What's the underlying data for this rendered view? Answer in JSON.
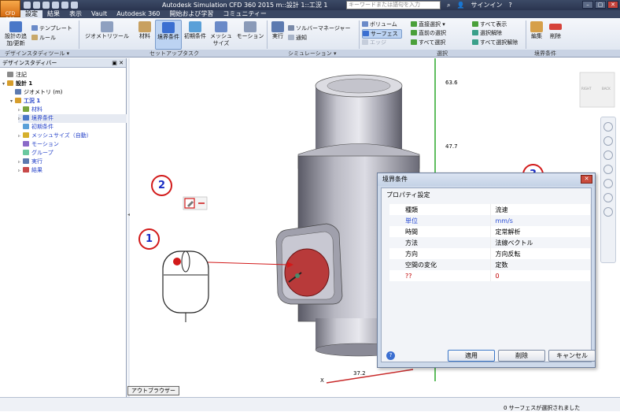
{
  "app": {
    "button_label": "CFD 360",
    "title": "Autodesk Simulation CFD 360 2015    m::設計 1::工況 1",
    "search_placeholder": "キーワードまたは語句を入力",
    "signin": "サインイン",
    "window_controls": [
      "–",
      "▢",
      "✕"
    ]
  },
  "tabs": [
    "設定",
    "結果",
    "表示",
    "Vault",
    "Autodesk 360",
    "開始および学習",
    "コミュニティー"
  ],
  "active_tab": "設定",
  "ribbon": {
    "design_study": {
      "big": "設計の追加/更新",
      "small": [
        "テンプレート",
        "ルール"
      ],
      "label": "デザインスタディツール ▾"
    },
    "setup": {
      "buttons": [
        "ジオメトリツール",
        "材料",
        "境界条件",
        "初期条件",
        "メッシュサイズ",
        "モーション"
      ],
      "label": "セットアップタスク"
    },
    "simulation": {
      "big": "実行",
      "small": [
        "ソルバーマネージャー",
        "通知"
      ],
      "label": "シミュレーション ▾"
    },
    "selection": {
      "col1": [
        "ボリューム",
        "サーフェス",
        "エッジ"
      ],
      "col2": [
        "直接選択",
        "直前の選択",
        "すべて選択"
      ],
      "col3": [
        "すべて表示",
        "選択解除",
        "すべて選択解除"
      ],
      "label": "選択"
    },
    "boundary": {
      "buttons": [
        "編集",
        "削除"
      ],
      "label": "境界条件"
    }
  },
  "panel": {
    "title": "デザインスタディバー",
    "controls": "▣ ✕",
    "items": [
      {
        "label": "注記",
        "indent": 0,
        "exp": "",
        "color": "#8a8a8a"
      },
      {
        "label": "設計 1",
        "indent": 0,
        "exp": "▾",
        "color": "#d69d2c",
        "bold": true
      },
      {
        "label": "ジオメトリ (m)",
        "indent": 1,
        "exp": "",
        "color": "#5c7ab0"
      },
      {
        "label": "工況 1",
        "indent": 1,
        "exp": "▾",
        "color": "#d69d2c",
        "bold": true,
        "blue": true
      },
      {
        "label": "材料",
        "indent": 2,
        "exp": "▹",
        "color": "#7aa63e",
        "blue": true
      },
      {
        "label": "境界条件",
        "indent": 2,
        "exp": "▹",
        "color": "#4a78c8",
        "blue": true,
        "sel": true
      },
      {
        "label": "初期条件",
        "indent": 2,
        "exp": "",
        "color": "#5aa0d8",
        "blue": true
      },
      {
        "label": "メッシュサイズ（自動）",
        "indent": 2,
        "exp": "▹",
        "color": "#d6b02c",
        "blue": true
      },
      {
        "label": "モーション",
        "indent": 2,
        "exp": "",
        "color": "#8a6ac8",
        "blue": true
      },
      {
        "label": "グループ",
        "indent": 2,
        "exp": "",
        "color": "#6ac8a0",
        "blue": true
      },
      {
        "label": "実行",
        "indent": 2,
        "exp": "▹",
        "color": "#5c7ab0",
        "blue": true
      },
      {
        "label": "結果",
        "indent": 2,
        "exp": "▹",
        "color": "#c84a4a",
        "blue": true
      }
    ]
  },
  "viewport": {
    "axis_values": [
      "63.6",
      "47.7",
      "37.2"
    ],
    "axis_x_label": "X",
    "viewcube_labels": [
      "RIGHT",
      "BACK"
    ]
  },
  "callouts": [
    "1",
    "2",
    "3"
  ],
  "dialog": {
    "title": "境界条件",
    "section": "プロパティ設定",
    "rows": [
      {
        "label": "種類",
        "value": "流速",
        "style": ""
      },
      {
        "label": "単位",
        "value": "mm/s",
        "style": "hl"
      },
      {
        "label": "時間",
        "value": "定常解析",
        "style": ""
      },
      {
        "label": "方法",
        "value": "法線ベクトル",
        "style": ""
      },
      {
        "label": "方向",
        "value": "方向反転",
        "style": ""
      },
      {
        "label": "空間の変化",
        "value": "定数",
        "style": ""
      },
      {
        "label": "??",
        "value": "0",
        "style": "red"
      }
    ],
    "buttons": {
      "apply": "適用",
      "delete": "削除",
      "cancel": "キャンセル"
    },
    "help": "?"
  },
  "status": {
    "browser_tab": "アウトブラウザー",
    "message": "0 サーフェスが選択されました"
  }
}
